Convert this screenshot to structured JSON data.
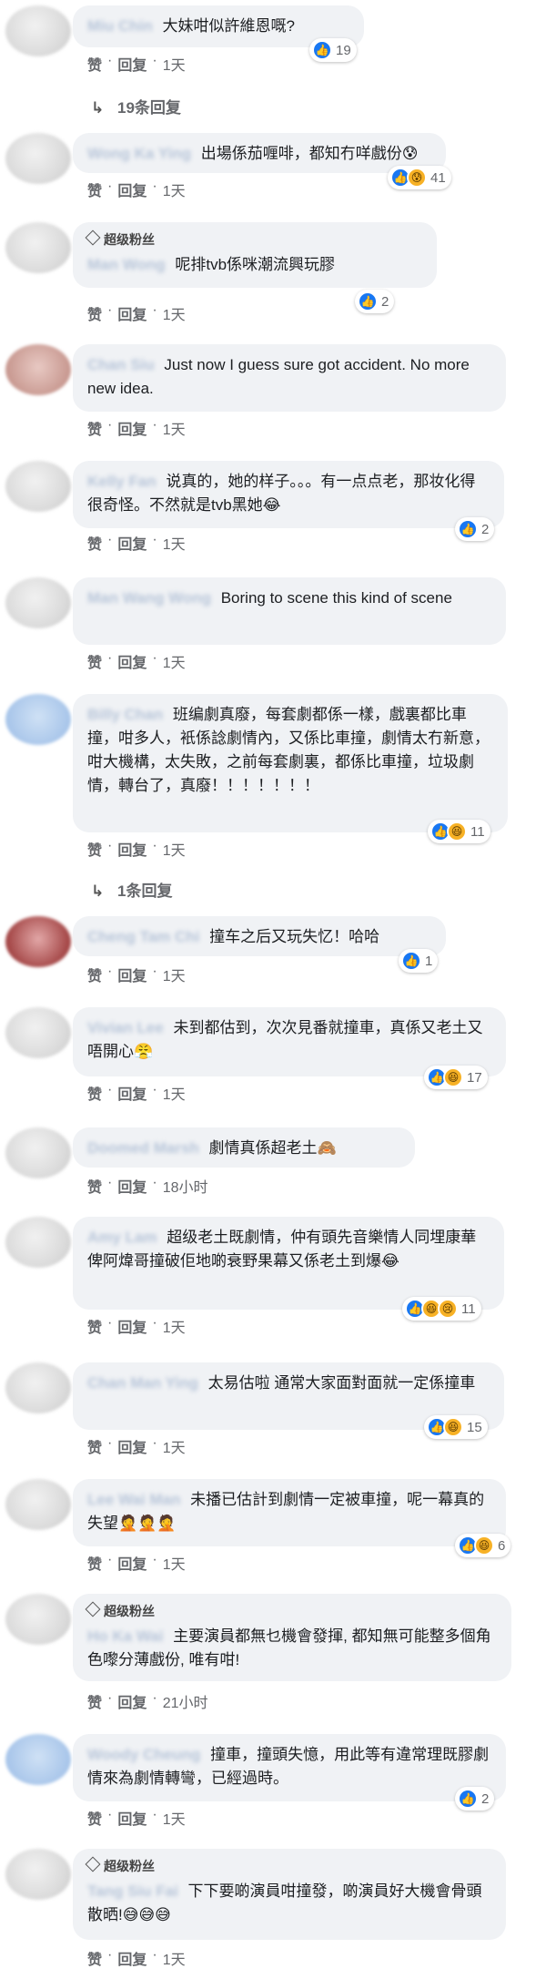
{
  "labels": {
    "like": "赞",
    "reply": "回复",
    "dot": "·",
    "fan_badge": "超级粉丝"
  },
  "comments": [
    {
      "author": "Miu Chin",
      "text": "大妹咁似許維恩嘅?",
      "time": "1天",
      "reactions": [
        "like"
      ],
      "count": "19",
      "replies": "19条回复"
    },
    {
      "author": "Wong Ka Ying",
      "text": "出場係茄喱啡，都知冇咩戲份😰",
      "time": "1天",
      "reactions": [
        "like",
        "haha"
      ],
      "count": "41"
    },
    {
      "author": "Man Wong",
      "text": "呢排tvb係咪潮流興玩膠",
      "time": "1天",
      "reactions": [
        "like"
      ],
      "count": "2",
      "fan": true
    },
    {
      "author": "Chan Siu",
      "text": "Just now I guess sure got accident. No more new idea.",
      "time": "1天",
      "reactions": [],
      "count": ""
    },
    {
      "author": "Kelly Fan",
      "text": "说真的，她的样子。。。有一点点老，那妆化得很奇怪。不然就是tvb黑她😂",
      "time": "1天",
      "reactions": [
        "like"
      ],
      "count": "2"
    },
    {
      "author": "Man Wang Wong",
      "text": "Boring to scene this kind of scene",
      "time": "1天",
      "reactions": [],
      "count": ""
    },
    {
      "author": "Billy Chan",
      "text": "班编劇真廢，每套劇都係一樣，戲裏都比車撞，咁多人，衹係諗劇情內，又係比車撞，劇情太冇新意，咁大機構，太失敗，之前每套劇裏，都係比車撞，垃圾劇情，轉台了，真廢！！！！！！！",
      "time": "1天",
      "reactions": [
        "like",
        "haha"
      ],
      "count": "11",
      "replies": "1条回复"
    },
    {
      "author": "Cheng Tam Chi",
      "text": "撞车之后又玩失忆！哈哈",
      "time": "1天",
      "reactions": [
        "like"
      ],
      "count": "1"
    },
    {
      "author": "Vivian Lee",
      "text": "未到都估到，次次見番就撞車，真係又老土又唔開心😤",
      "time": "1天",
      "reactions": [
        "like",
        "haha"
      ],
      "count": "17"
    },
    {
      "author": "Doomed Marsh",
      "text": "劇情真係超老土🙈",
      "time": "18小时",
      "reactions": [],
      "count": ""
    },
    {
      "author": "Amy Lam",
      "text": "超级老土既劇情，仲有頭先音樂情人同埋康華俾阿煒哥撞破佢地啲衰野果幕又係老土到爆😂",
      "time": "1天",
      "reactions": [
        "like",
        "haha",
        "sad"
      ],
      "count": "11"
    },
    {
      "author": "Chan Man Ying",
      "text": "太易估啦 通常大家面對面就一定係撞車",
      "time": "1天",
      "reactions": [
        "like",
        "haha"
      ],
      "count": "15"
    },
    {
      "author": "Lee Wai Man",
      "text": "未播已估計到劇情一定被車撞，呢一幕真的失望🤦🤦🤦",
      "time": "1天",
      "reactions": [
        "like",
        "haha"
      ],
      "count": "6"
    },
    {
      "author": "Ho Ka Wai",
      "text": "主要演員都無乜機會發揮, 都知無可能整多個角色嚟分薄戲份, 唯有咁!",
      "time": "21小时",
      "reactions": [],
      "count": "",
      "fan": true
    },
    {
      "author": "Woody Cheung",
      "text": "撞車，撞頭失憶，用此等有違常理既膠劇情來為劇情轉彎，已經過時。",
      "time": "1天",
      "reactions": [
        "like"
      ],
      "count": "2"
    },
    {
      "author": "Tang Siu Fai",
      "text": "下下要啲演員咁撞發，啲演員好大機會骨頭散晒!😅😅😅",
      "time": "1天",
      "reactions": [],
      "count": "",
      "fan": true
    }
  ]
}
